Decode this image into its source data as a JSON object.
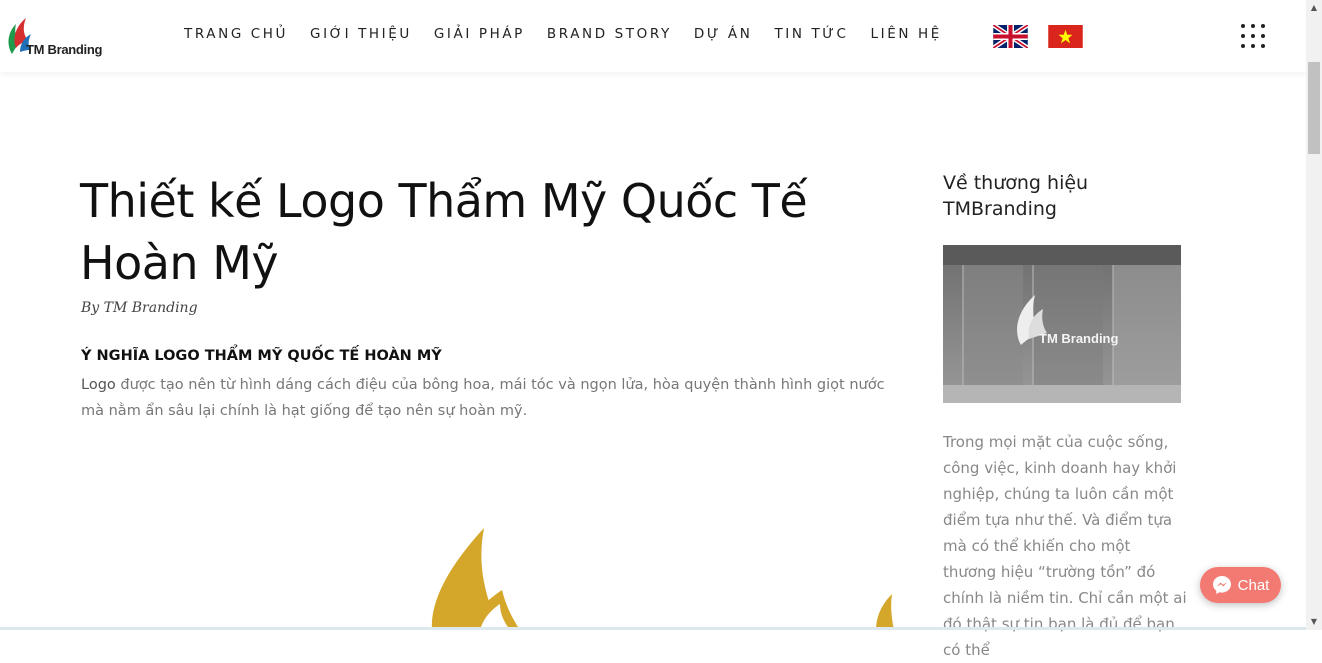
{
  "brand": {
    "name": "TM Branding"
  },
  "nav": {
    "items": [
      "TRANG CHỦ",
      "GIỚI THIỆU",
      "GIẢI PHÁP",
      "BRAND STORY",
      "DỰ ÁN",
      "TIN TỨC",
      "LIÊN HỆ"
    ]
  },
  "icons": {
    "uk_flag": "uk-flag-icon",
    "vn_flag": "vietnam-flag-icon",
    "menu": "grid-menu-icon",
    "chat": "messenger-icon"
  },
  "article": {
    "title": "Thiết kế Logo Thẩm Mỹ Quốc Tế Hoàn Mỹ",
    "byline": "By TM Branding",
    "section_heading": "Ý NGHĨA LOGO THẨM MỸ QUỐC TẾ HOÀN MỸ",
    "paragraph_lead": "Logo",
    "paragraph_rest": " được tạo nên từ hình dáng cách điệu của bông hoa, mái tóc và ngọn lửa, hòa quyện thành hình giọt nước mà nằm ẩn sâu lại chính là hạt giống để tạo nên sự hoàn mỹ."
  },
  "sidebar": {
    "title": "Về thương hiệu TMBranding",
    "image_logo_text": "TM Branding",
    "text": "Trong mọi mặt của cuộc sống, công việc, kinh doanh hay khởi nghiệp, chúng ta luôn cần một điểm tựa như thế. Và điểm tựa mà có thể khiến cho một thương hiệu “trường tồn” đó chính là niềm tin. Chỉ cần một ai đó thật sự tin bạn là đủ để bạn có thể"
  },
  "chat": {
    "label": "Chat"
  },
  "colors": {
    "chat_bg": "#f37a72",
    "logo_red": "#d62f2f",
    "logo_green": "#1f9a4a",
    "logo_blue": "#1d6fb8",
    "gold": "#d4a62a"
  }
}
